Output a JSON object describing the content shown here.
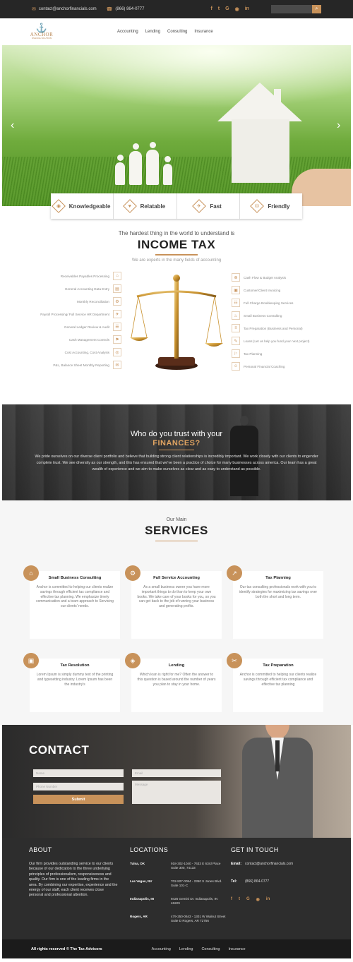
{
  "topbar": {
    "email": "contact@anchorfinancials.com",
    "phone": "(866) 864-0777",
    "social": [
      "f",
      "t",
      "G",
      "rss",
      "in"
    ],
    "search_button": "🔍"
  },
  "logo": {
    "symbol": "⚓",
    "name": "ANCHOR",
    "tagline": "FINANCIAL SOLUTIONS"
  },
  "nav": [
    "Accounting",
    "Lending",
    "Consulting",
    "Insurance"
  ],
  "hero": {
    "prev": "‹",
    "next": "›"
  },
  "features": [
    {
      "icon": "◉",
      "label": "Knowledgeable"
    },
    {
      "icon": "♥",
      "label": "Relatable"
    },
    {
      "icon": "✈",
      "label": "Fast"
    },
    {
      "icon": "⛁",
      "label": "Friendly"
    }
  ],
  "income": {
    "pre": "The hardest thing in the world to understand is",
    "title": "INCOME TAX",
    "sub": "We are experts in the many fields of accounting"
  },
  "left_services": [
    {
      "icon": "⌂",
      "label": "Receivables Payables Processing"
    },
    {
      "icon": "▤",
      "label": "General Accounting Data Entry"
    },
    {
      "icon": "⚙",
      "label": "Monthly Reconciliation"
    },
    {
      "icon": "✈",
      "label": "Payroll Processing/ Full Service HR Department"
    },
    {
      "icon": "☰",
      "label": "General Ledger Review & Audit"
    },
    {
      "icon": "⚑",
      "label": "Cash Management Controls"
    },
    {
      "icon": "◎",
      "label": "Cost Accounting, Cost Analysis"
    },
    {
      "icon": "✉",
      "label": "P&L, Balance Sheet Monthly Reporting"
    }
  ],
  "right_services": [
    {
      "icon": "⊕",
      "label": "Cash Flow & Budget Analysis"
    },
    {
      "icon": "▣",
      "label": "Customer/Client Invoicing"
    },
    {
      "icon": "☷",
      "label": "Full Charge Bookkeeping Services"
    },
    {
      "icon": "♨",
      "label": "Small Business Consulting"
    },
    {
      "icon": "≡",
      "label": "Tax Preparation (Business and Personal)"
    },
    {
      "icon": "✎",
      "label": "Loans (Let us help you fund your next project)"
    },
    {
      "icon": "⚐",
      "label": "Tax Planning"
    },
    {
      "icon": "☺",
      "label": "Personal Financial Coaching"
    }
  ],
  "trust": {
    "question": "Who do you trust with your",
    "highlight": "FINANCES?",
    "body": "We pride ourselves on our diverse client portfolio and believe that building strong client relationships is incredibly important. We work closely with our clients to engender complete trust. We see diversity as our strength, and this has ensured that we've been a practice of choice for many businesses across america. Our team has a great wealth of experience and we aim to make ourselves as clear and as easy to understand as possible."
  },
  "services": {
    "pre": "Our Main",
    "title": "SERVICES",
    "cards": [
      {
        "icon": "⌂",
        "title": "Small Business Consulting",
        "desc": "Anchor is committed to helping our clients realize savings through efficient tax compliance and effective tax planning. We emphasize timely communication and a team approach to Servicing our clients' needs."
      },
      {
        "icon": "⚙",
        "title": "Full Service Accounting",
        "desc": "As a small business owner you have more important things to do than to keep your own books. We take care of your books for you, so you can get back to the job of running your business and generating profits."
      },
      {
        "icon": "↗",
        "title": "Tax Planning",
        "desc": "Our tax consulting professionals work with you to identify strategies for maximizing tax savings over both the short and long term."
      },
      {
        "icon": "▣",
        "title": "Tax Resolution",
        "desc": "Lorem Ipsum is simply dummy text of the printing and typesetting industry. Lorem Ipsum has been the industry's"
      },
      {
        "icon": "◈",
        "title": "Lending",
        "desc": "Which loan is right for me? Often the answer to this question is based around the number of years you plan to stay in your home."
      },
      {
        "icon": "✂",
        "title": "Tax Preparation",
        "desc": "Anchor is committed to helping our clients realize savings through efficient tax compliance and effective tax planning"
      }
    ]
  },
  "contact": {
    "title": "CONTACT",
    "name_placeholder": "Name",
    "email_placeholder": "Email",
    "phone_placeholder": "Phone Number",
    "message_placeholder": "Message",
    "submit": "Submit"
  },
  "footer": {
    "about_title": "ABOUT",
    "about_text": "Our firm provides outstanding service to our clients because of our dedication to the three underlying principles of professionalism, responsiveness and quality. Our firm is one of the leading firms in the area. By combining our expertise, experience and the energy of our staff, each client receives close personal and professional attention.",
    "locations_title": "LOCATIONS",
    "locations": [
      {
        "city": "Tulsa, OK",
        "address": "918-302-1040 - 7633 E 63rd Place Suite 300, 74133"
      },
      {
        "city": "Las Vegas, NV",
        "address": "702-827-0054 - 2350 S Jones Blvd. Suite 101-C"
      },
      {
        "city": "Indianapolis, IN",
        "address": "9426 Gemini Dr. Indianapolis, IN 46229"
      },
      {
        "city": "Rogers, AR",
        "address": "479-250-0643 - 1301 W Walnut Street Suite D Rogers, AR 72756"
      }
    ],
    "touch_title": "GET IN TOUCH",
    "email_label": "Email:",
    "email": "contact@anchorfinancials.com",
    "tel_label": "Tel:",
    "tel": "(866) 864-0777",
    "social": [
      "f",
      "t",
      "G",
      "rss",
      "in"
    ]
  },
  "bottom": {
    "rights": "All rights reserved © The Tax Advisors",
    "links": [
      "Accounting",
      "Lending",
      "Consulting",
      "Insurance"
    ]
  }
}
